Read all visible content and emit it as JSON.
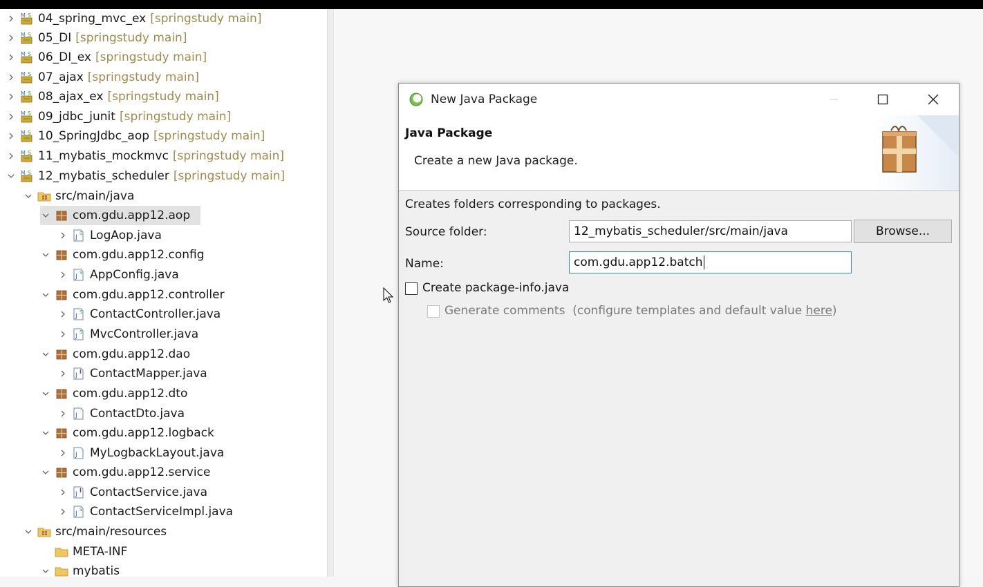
{
  "explorer": {
    "projects": [
      {
        "name": "04_spring_mvc_ex",
        "decoration": "[springstudy main]"
      },
      {
        "name": "05_DI",
        "decoration": "[springstudy main]"
      },
      {
        "name": "06_DI_ex",
        "decoration": "[springstudy main]"
      },
      {
        "name": "07_ajax",
        "decoration": "[springstudy main]"
      },
      {
        "name": "08_ajax_ex",
        "decoration": "[springstudy main]"
      },
      {
        "name": "09_jdbc_junit",
        "decoration": "[springstudy main]"
      },
      {
        "name": "10_SpringJdbc_aop",
        "decoration": "[springstudy main]"
      },
      {
        "name": "11_mybatis_mockmvc",
        "decoration": "[springstudy main]"
      },
      {
        "name": "12_mybatis_scheduler",
        "decoration": "[springstudy main]"
      }
    ],
    "src_main_java": "src/main/java",
    "packages": [
      {
        "name": "com.gdu.app12.aop",
        "files": [
          "LogAop.java"
        ]
      },
      {
        "name": "com.gdu.app12.config",
        "files": [
          "AppConfig.java"
        ]
      },
      {
        "name": "com.gdu.app12.controller",
        "files": [
          "ContactController.java",
          "MvcController.java"
        ]
      },
      {
        "name": "com.gdu.app12.dao",
        "files": [
          "ContactMapper.java"
        ]
      },
      {
        "name": "com.gdu.app12.dto",
        "files": [
          "ContactDto.java"
        ]
      },
      {
        "name": "com.gdu.app12.logback",
        "files": [
          "MyLogbackLayout.java"
        ]
      },
      {
        "name": "com.gdu.app12.service",
        "files": [
          "ContactService.java",
          "ContactServiceImpl.java"
        ]
      }
    ],
    "src_main_resources": "src/main/resources",
    "folders": [
      "META-INF",
      "mybatis"
    ]
  },
  "dialog": {
    "window_title": "New Java Package",
    "banner_title": "Java Package",
    "banner_subtitle": "Create a new Java package.",
    "description": "Creates folders corresponding to packages.",
    "source_folder_label": "Source folder:",
    "source_folder_value": "12_mybatis_scheduler/src/main/java",
    "browse_label": "Browse...",
    "name_label": "Name:",
    "name_value": "com.gdu.app12.batch",
    "create_package_info_label": "Create package-info.java",
    "create_package_info_checked": false,
    "generate_comments_label": "Generate comments",
    "generate_comments_hint_prefix": "(configure templates and default value ",
    "generate_comments_link": "here",
    "generate_comments_hint_suffix": ")",
    "generate_comments_enabled": false
  },
  "colors": {
    "decoration": "#a08a4e",
    "selection": "#e2e2e2",
    "focus_border": "#3c84d6"
  },
  "icons": {
    "project": "spring-project-icon",
    "source_folder": "source-folder-icon",
    "package": "package-icon",
    "java_file": "java-file-icon",
    "folder": "folder-icon"
  }
}
